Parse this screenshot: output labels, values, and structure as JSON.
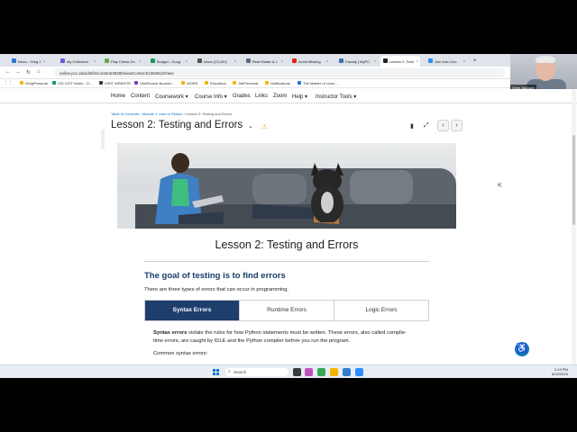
{
  "browser": {
    "tabs": [
      {
        "label": "Inbox - Greg J",
        "color": "#2a74d6",
        "active": false
      },
      {
        "label": "My Collection",
        "color": "#6b5bd2",
        "active": false
      },
      {
        "label": "Play Chess On",
        "color": "#6aa84f",
        "active": false
      },
      {
        "label": "Budget - Goog",
        "color": "#0f9d58",
        "active": false
      },
      {
        "label": "Inbox (23,281)",
        "color": "#555555",
        "active": false
      },
      {
        "label": "Real Estate & L",
        "color": "#5a6b7d",
        "active": false
      },
      {
        "label": "Avoid Missing",
        "color": "#e02020",
        "active": false
      },
      {
        "label": "Faculty | MyPC",
        "color": "#3d6fb6",
        "active": false
      },
      {
        "label": "Lesson 2: Testi",
        "color": "#222222",
        "active": true
      },
      {
        "label": "Join from Zoo",
        "color": "#2d8cff",
        "active": false
      }
    ],
    "url": "online.pcc.edu/d2l/le/content/39280/viewContent/1384813/View",
    "bookmarks": [
      {
        "label": "GregPersonal",
        "color": "#f4b400"
      },
      {
        "label": "CIS 122T Notes - G...",
        "color": "#0f9d58"
      },
      {
        "label": "VISIT WEBSITE",
        "color": "#3a3a3a"
      },
      {
        "label": "VitalSource Booksh...",
        "color": "#7a3fb8"
      },
      {
        "label": "WORK",
        "color": "#f4b400"
      },
      {
        "label": "Education",
        "color": "#f4b400"
      },
      {
        "label": "JimPersonal",
        "color": "#f4b400"
      },
      {
        "label": "Notifications",
        "color": "#f4b400"
      },
      {
        "label": "The Master of Licen...",
        "color": "#2a74d6"
      }
    ]
  },
  "webcam": {
    "name": "Greg Jackson"
  },
  "site_nav": {
    "items": [
      "Home",
      "Content",
      "Coursework ▾",
      "Course Info ▾",
      "Grades",
      "Links",
      "Zoom",
      "Help ▾",
      "Instructor Tools ▾"
    ]
  },
  "breadcrumb": {
    "toc": "Table of Contents",
    "module": "Module 1: Intro to Python",
    "current": "Lesson 2: Testing and Errors"
  },
  "lesson": {
    "title": "Lesson 2: Testing and Errors",
    "content_title": "Lesson 2: Testing and Errors",
    "heading": "The goal of testing is to find errors",
    "intro": "There are three types of errors that can occur in programming.",
    "tabs": [
      "Syntax Errors",
      "Runtime Errors",
      "Logic Errors"
    ],
    "para_bold": "Syntax errors",
    "para_rest": " violate the rules for how Python statements must be written. These errors, also called compile-time errors, are caught by IDLE and the Python compiler before you run the program.",
    "common": "Common syntax errors:"
  },
  "taskbar": {
    "search": "Search",
    "time": "2:19 PM",
    "date": "6/22/2024"
  }
}
